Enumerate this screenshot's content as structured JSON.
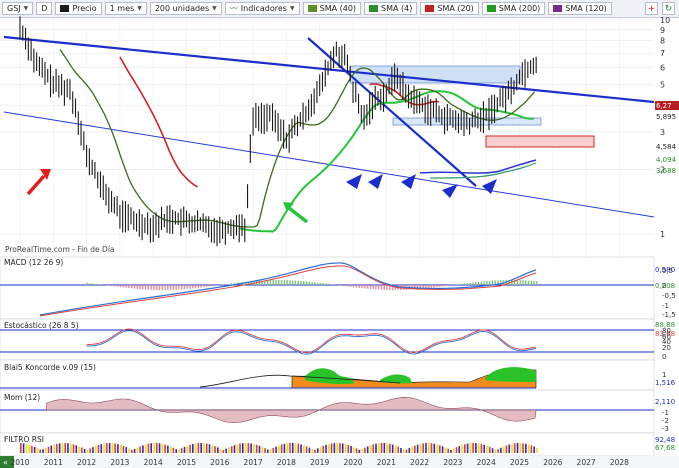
{
  "toolbar": {
    "ticker": "GSJ",
    "d_label": "D",
    "price_label": "Precio",
    "period": "1 mes",
    "units": "200 unidades",
    "indicators_label": "Indicadores",
    "sma_labels": [
      "SMA (40)",
      "SMA (4)",
      "SMA (20)",
      "SMA (200)",
      "SMA (120)"
    ],
    "sma_colors": [
      "#5a8f29",
      "#2a8f2a",
      "#c02020",
      "#1e9d1e",
      "#7a2a8f"
    ],
    "right_icons": [
      "plus-icon",
      "refresh-icon"
    ]
  },
  "main": {
    "watermark": "ProRealTime.com - Fin de Día",
    "price_badges": [
      {
        "text": "6,27",
        "bg": "#b52020",
        "fg": "#ffffff"
      },
      {
        "text": "5,895",
        "bg": "#ffffff",
        "fg": "#222222"
      },
      {
        "text": "4,584",
        "bg": "#ffffff",
        "fg": "#222222"
      },
      {
        "text": "4,094",
        "bg": "#ffffff",
        "fg": "#222222"
      },
      {
        "text": "3,688",
        "bg": "#ffffff",
        "fg": "#222222"
      }
    ]
  },
  "panels": {
    "macd": {
      "title": "MACD (12 26 9)",
      "badges": [
        "0,580",
        "0,208"
      ]
    },
    "stoch": {
      "title": "Estocástico (26 8 5)",
      "badges": [
        "88,88",
        "83,88"
      ]
    },
    "koncorde": {
      "title": "Blai5 Koncorde v.09 (15)",
      "badges": [
        "1,516"
      ]
    },
    "mom": {
      "title": "Mom (12)",
      "badges": [
        "2,110"
      ]
    },
    "rsi": {
      "title": "FILTRO RSI",
      "badges": [
        "92,48",
        "67,68"
      ]
    }
  },
  "chart_data": [
    {
      "type": "line",
      "title": "GSJ",
      "x": [
        2010.0,
        2010.5,
        2011.0,
        2011.5,
        2012.0,
        2012.5,
        2013.0,
        2013.5,
        2014.0,
        2014.5,
        2015.0,
        2015.5,
        2016.0,
        2016.5,
        2016.8,
        2017.0,
        2017.5,
        2018.0,
        2018.5,
        2019.0,
        2019.5,
        2019.8,
        2020.0,
        2020.3,
        2020.6,
        2021.0,
        2021.3,
        2021.6,
        2022.0,
        2022.5,
        2023.0,
        2023.5,
        2024.0,
        2024.4,
        2024.8,
        2025.0,
        2025.2,
        2025.5
      ],
      "series": [
        {
          "name": "Precio",
          "values": [
            9.3,
            6.2,
            5.1,
            4.7,
            2.3,
            1.6,
            1.25,
            1.15,
            1.1,
            1.2,
            1.15,
            1.1,
            1.05,
            1.1,
            1.1,
            3.5,
            3.6,
            2.8,
            3.5,
            4.8,
            7.2,
            6.5,
            4.8,
            3.4,
            4.2,
            4.6,
            5.6,
            4.5,
            4.1,
            3.7,
            3.4,
            3.3,
            3.6,
            4.2,
            4.8,
            5.5,
            5.9,
            6.27
          ]
        }
      ],
      "y_ticks": [
        1,
        2,
        3,
        4,
        5,
        6,
        7,
        8,
        9,
        10
      ],
      "y_scale": "log",
      "x_ticks": [
        "2010",
        "2011",
        "2012",
        "2013",
        "2014",
        "2015",
        "2016",
        "2017",
        "2018",
        "2019",
        "2020",
        "2021",
        "2022",
        "2023",
        "2024",
        "2025",
        "2026",
        "2027",
        "2028"
      ],
      "grid": true
    },
    {
      "type": "line",
      "title": "MACD (12 26 9)",
      "y_ticks": [
        "0,5",
        "0",
        "-0,5",
        "-1",
        "-1,5"
      ]
    },
    {
      "type": "line",
      "title": "Estocástico (26 8 5)",
      "y_ticks": [
        "80",
        "60",
        "40",
        "20",
        "0"
      ]
    },
    {
      "type": "area",
      "title": "Blai5 Koncorde v.09 (15)",
      "y_ticks": [
        "1"
      ]
    },
    {
      "type": "line",
      "title": "Mom (12)",
      "y_ticks": [
        "-1",
        "-2",
        "-3"
      ]
    },
    {
      "type": "line",
      "title": "FILTRO RSI",
      "y_ticks": []
    }
  ]
}
